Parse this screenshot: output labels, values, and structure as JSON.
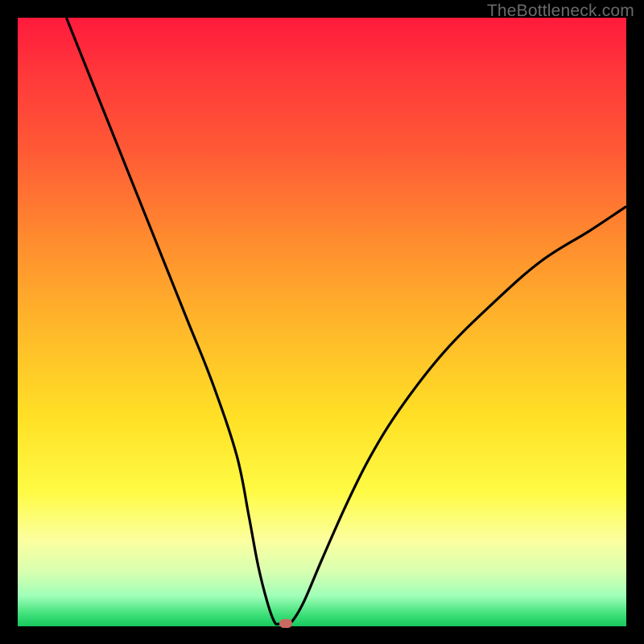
{
  "watermark": "TheBottleneck.com",
  "chart_data": {
    "type": "line",
    "title": "",
    "xlabel": "",
    "ylabel": "",
    "xlim": [
      0,
      100
    ],
    "ylim": [
      0,
      100
    ],
    "grid": false,
    "series": [
      {
        "name": "bottleneck-curve",
        "x": [
          8,
          12,
          16,
          20,
          24,
          28,
          32,
          36,
          38,
          39.5,
          41,
          42.2,
          43,
          44,
          45,
          47,
          50,
          54,
          58,
          63,
          70,
          78,
          86,
          94,
          100
        ],
        "y": [
          100,
          90,
          80,
          70,
          60,
          50,
          40,
          28,
          18,
          10,
          4,
          0.7,
          0.4,
          0.4,
          0.7,
          4,
          11,
          20,
          28,
          36,
          45,
          53,
          60,
          65,
          69
        ]
      }
    ],
    "marker": {
      "x": 44,
      "y": 0.4
    },
    "flat_bottom": {
      "x_start": 42.2,
      "x_end": 45,
      "y": 0.4
    },
    "colors": {
      "curve": "#000000",
      "marker": "#c96a60",
      "gradient_top": "#ff1a3c",
      "gradient_bottom": "#18c85e"
    }
  }
}
